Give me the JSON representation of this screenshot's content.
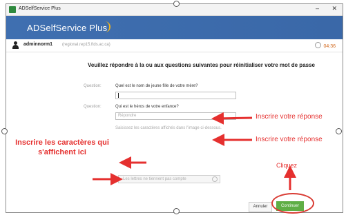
{
  "window": {
    "title": "ADSelfService Plus",
    "minimize_glyph": "–",
    "close_glyph": "✕"
  },
  "header": {
    "brand": "ADSelfService Plus"
  },
  "userbar": {
    "username": "adminnorm1",
    "domain": "(regional.rep15.ftds.ac.ca)",
    "timer": "04:36"
  },
  "content": {
    "instruction": "Veuillez répondre à la ou aux questions suivantes pour réinitialiser votre mot de passe",
    "questions": [
      {
        "label": "Question:",
        "text": "Quel est le nom de jeune fille de votre mère?",
        "placeholder": ""
      },
      {
        "label": "Question:",
        "text": "Qui est le héros de votre enfance?",
        "placeholder": "Répondre"
      }
    ],
    "captcha_hint": "Saisissez les caractères affichés dans l'image ci-dessous.",
    "captcha_placeholder": "Les lettres ne tiennent pas compte",
    "buttons": {
      "cancel": "Annuler",
      "continue": "Continuer"
    }
  },
  "annotations": {
    "answer_1": "Inscrire votre réponse",
    "answer_2": "Inscrire votre réponse",
    "captcha": "Inscrire les caractères qui s'affichent ici",
    "click": "Cliquez"
  },
  "colors": {
    "header": "#3f6fb0",
    "continue_button": "#5fae45",
    "annotation": "#e5302f"
  }
}
